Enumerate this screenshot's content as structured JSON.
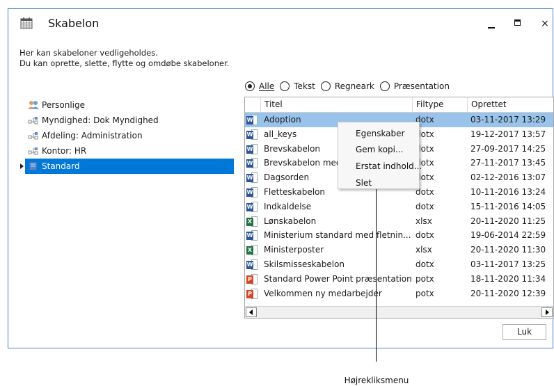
{
  "window": {
    "title": "Skabelon",
    "controls": {
      "minimize": "minimize",
      "maximize": "maximize",
      "close": "×"
    }
  },
  "description": {
    "line1": "Her kan skabeloner vedligeholdes.",
    "line2": "Du kan oprette, slette, flytte og omdøbe skabeloner."
  },
  "tree": {
    "items": [
      {
        "label": "Personlige",
        "icon": "people-icon"
      },
      {
        "label": "Myndighed: Dok Myndighed",
        "icon": "org-icon"
      },
      {
        "label": "Afdeling: Administration",
        "icon": "org-icon"
      },
      {
        "label": "Kontor: HR",
        "icon": "org-icon"
      },
      {
        "label": "Standard",
        "icon": "folder-icon",
        "selected": true
      }
    ]
  },
  "filter": {
    "options": [
      "Alle",
      "Tekst",
      "Regneark",
      "Præsentation"
    ],
    "selected": "Alle"
  },
  "table": {
    "headers": [
      "Titel",
      "Filtype",
      "Oprettet"
    ],
    "rows": [
      {
        "icon": "word",
        "title": "Adoption",
        "type": "dotx",
        "created": "03-11-2017 13:29",
        "selected": true
      },
      {
        "icon": "word",
        "title": "all_keys",
        "type": "dotx",
        "created": "19-12-2017 13:57"
      },
      {
        "icon": "word",
        "title": "Brevskabelon",
        "type": "dotx",
        "created": "27-09-2017 14:25"
      },
      {
        "icon": "word",
        "title": "Brevskabelon med",
        "type": "dotx",
        "created": "27-11-2017 13:45"
      },
      {
        "icon": "word",
        "title": "Dagsorden",
        "type": "dotx",
        "created": "02-12-2016 13:07"
      },
      {
        "icon": "word",
        "title": "Fletteskabelon",
        "type": "dotx",
        "created": "10-11-2016 13:24"
      },
      {
        "icon": "word",
        "title": "Indkaldelse",
        "type": "dotx",
        "created": "15-11-2016 14:05"
      },
      {
        "icon": "excel",
        "title": "Lønskabelon",
        "type": "xlsx",
        "created": "20-11-2020 11:25"
      },
      {
        "icon": "word",
        "title": "Ministerium standard med fletnin...",
        "type": "dotx",
        "created": "19-06-2014 22:59"
      },
      {
        "icon": "excel",
        "title": "Ministerposter",
        "type": "xlsx",
        "created": "20-11-2020 11:30"
      },
      {
        "icon": "word",
        "title": "Skilsmisseskabelon",
        "type": "dotx",
        "created": "03-11-2017 13:25"
      },
      {
        "icon": "ppt",
        "title": "Standard Power Point præsentation",
        "type": "potx",
        "created": "18-11-2020 11:34"
      },
      {
        "icon": "ppt",
        "title": "Velkommen ny medarbejder",
        "type": "potx",
        "created": "20-11-2020 12:39"
      }
    ]
  },
  "context_menu": {
    "items": [
      "Egenskaber",
      "Gem kopi...",
      "Erstat indhold...",
      "Slet"
    ]
  },
  "close_button": "Luk",
  "annotation": "Højrekliksmenu",
  "colors": {
    "accent": "#0078d7",
    "row_selected": "#99c3ea",
    "word": "#2b579a",
    "excel": "#217346",
    "ppt": "#d24726"
  }
}
